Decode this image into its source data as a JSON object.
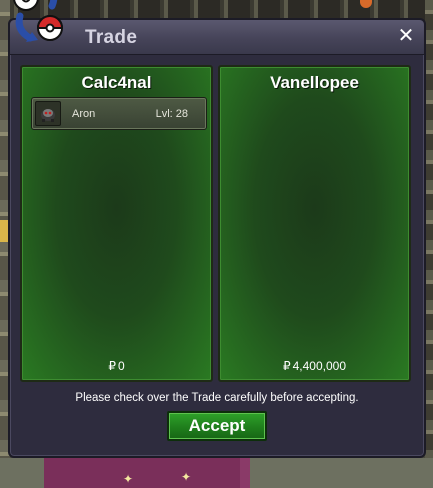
{
  "window": {
    "title": "Trade",
    "close_icon": "close-icon"
  },
  "logo_icon": "trade-pokeballs-icon",
  "left_panel": {
    "trainer": "Calc4nal",
    "pokemon": [
      {
        "name": "Aron",
        "level": "Lvl: 28",
        "icon": "aron-sprite-icon"
      }
    ],
    "currency_symbol": "₽",
    "money": "0"
  },
  "right_panel": {
    "trainer": "Vanellopee",
    "pokemon": [],
    "currency_symbol": "₽",
    "money": "4,400,000"
  },
  "notice": "Please check over the Trade carefully before accepting.",
  "accept_label": "Accept",
  "colors": {
    "panel_green": "#2a7a22",
    "button_green": "#1f7e1c",
    "dialog_bg": "#2e2c3e"
  }
}
